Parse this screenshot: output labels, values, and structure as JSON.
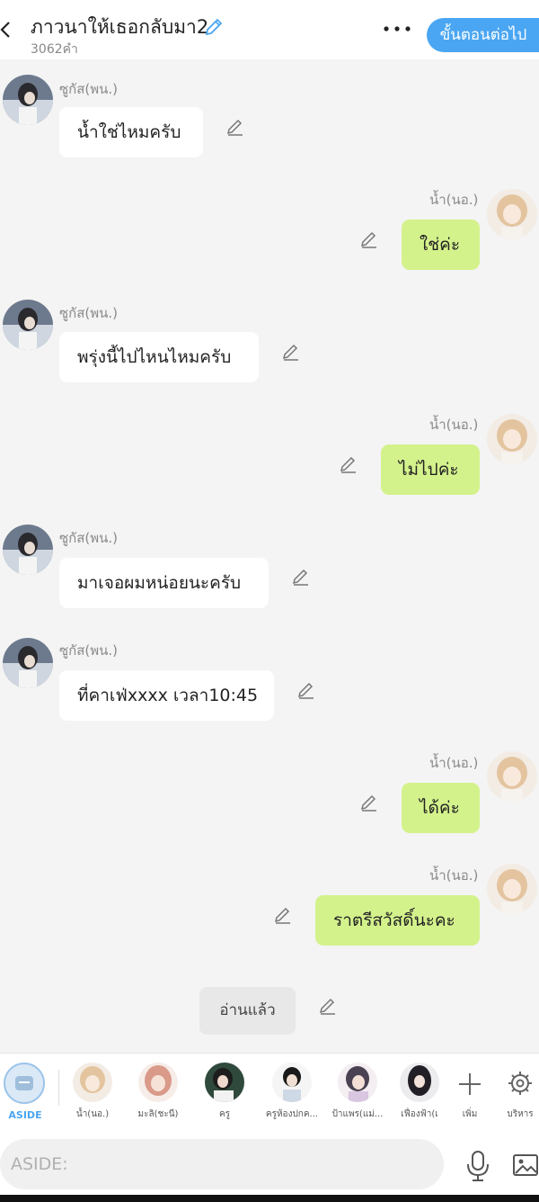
{
  "header": {
    "title": "ภาวนาให้เธอกลับมา2",
    "word_count": "3062คำ",
    "next_button": "ขั้นตอนต่อไป"
  },
  "messages": [
    {
      "side": "left",
      "name": "ซูกัส(พน.)",
      "text": "น้ำใช่ไหมครับ"
    },
    {
      "side": "right",
      "name": "น้ำ(นอ.)",
      "text": "ใช่ค่ะ"
    },
    {
      "side": "left",
      "name": "ซูกัส(พน.)",
      "text": "พรุ่งนี้ไปไหนไหมครับ"
    },
    {
      "side": "right",
      "name": "น้ำ(นอ.)",
      "text": "ไม่ไปค่ะ"
    },
    {
      "side": "left",
      "name": "ซูกัส(พน.)",
      "text": "มาเจอผมหน่อยนะครับ"
    },
    {
      "side": "left",
      "name": "ซูกัส(พน.)",
      "text": "ที่คาเฟ่xxxx เวลา10:45"
    },
    {
      "side": "right",
      "name": "น้ำ(นอ.)",
      "text": "ได้ค่ะ"
    },
    {
      "side": "right",
      "name": "น้ำ(นอ.)",
      "text": "ราตรีสวัสดิ์นะคะ"
    }
  ],
  "read_status": "อ่านแล้ว",
  "characters": {
    "aside_label": "ASIDE",
    "list": [
      "น้ำ(นอ.)",
      "มะลิ(ชะนี)",
      "ครู",
      "ครูห้องปกค...",
      "ป้าแพร(แม่...",
      "เฟื่องฟ้า(เ"
    ],
    "add_label": "เพิ่ม",
    "manage_label": "บริหาร"
  },
  "input": {
    "placeholder": "ASIDE:"
  },
  "colors": {
    "accent": "#4aa6f2",
    "right_bubble": "#d4f28c",
    "left_bubble": "#ffffff",
    "background": "#f4f4f4"
  }
}
